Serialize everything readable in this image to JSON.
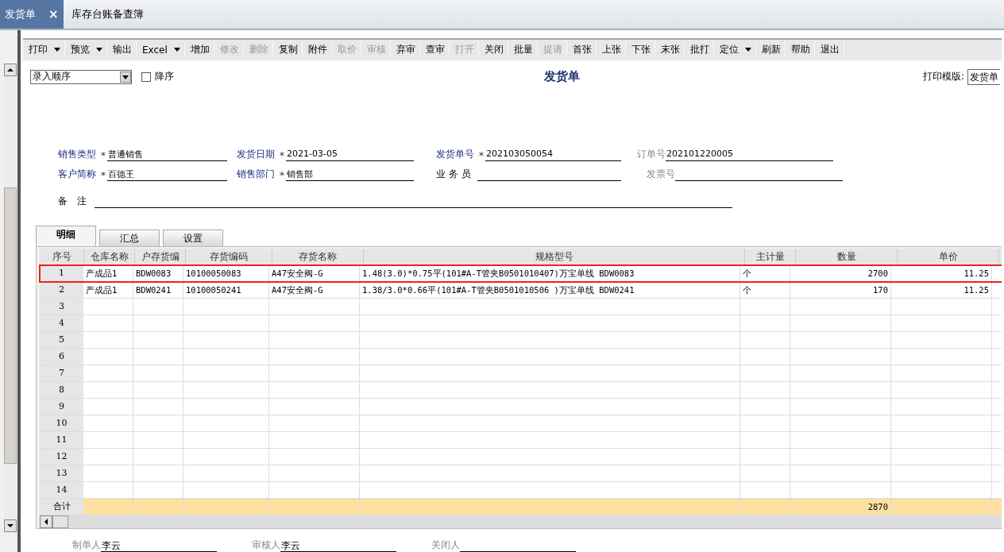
{
  "doc_tabs": [
    {
      "label": "发货单",
      "selected": true,
      "close": "×"
    },
    {
      "label": "库存台账备查簿",
      "selected": false
    }
  ],
  "toolbar": [
    {
      "label": "打印",
      "disabled": false,
      "dropdown": true
    },
    {
      "label": "预览",
      "disabled": false,
      "dropdown": true
    },
    {
      "label": "输出",
      "disabled": false,
      "dropdown": false
    },
    {
      "label": "Excel",
      "disabled": false,
      "dropdown": true
    },
    {
      "label": "增加",
      "disabled": false,
      "dropdown": false
    },
    {
      "label": "修改",
      "disabled": true,
      "dropdown": false
    },
    {
      "label": "删除",
      "disabled": true,
      "dropdown": false
    },
    {
      "label": "复制",
      "disabled": false,
      "dropdown": false
    },
    {
      "label": "附件",
      "disabled": false,
      "dropdown": false
    },
    {
      "label": "取价",
      "disabled": true,
      "dropdown": false
    },
    {
      "label": "审核",
      "disabled": true,
      "dropdown": false
    },
    {
      "label": "弃审",
      "disabled": false,
      "dropdown": false
    },
    {
      "label": "查审",
      "disabled": false,
      "dropdown": false
    },
    {
      "label": "打开",
      "disabled": true,
      "dropdown": false
    },
    {
      "label": "关闭",
      "disabled": false,
      "dropdown": false
    },
    {
      "label": "批量",
      "disabled": false,
      "dropdown": false
    },
    {
      "label": "提请",
      "disabled": true,
      "dropdown": false
    },
    {
      "label": "首张",
      "disabled": false,
      "dropdown": false
    },
    {
      "label": "上张",
      "disabled": false,
      "dropdown": false
    },
    {
      "label": "下张",
      "disabled": false,
      "dropdown": false
    },
    {
      "label": "末张",
      "disabled": false,
      "dropdown": false
    },
    {
      "label": "批打",
      "disabled": false,
      "dropdown": false
    },
    {
      "label": "定位",
      "disabled": false,
      "dropdown": true
    },
    {
      "label": "刷新",
      "disabled": false,
      "dropdown": false
    },
    {
      "label": "帮助",
      "disabled": false,
      "dropdown": false
    },
    {
      "label": "退出",
      "disabled": false,
      "dropdown": false
    }
  ],
  "sort": {
    "value": "录入顺序",
    "descending_label": "降序",
    "descending": false
  },
  "title": "发货单",
  "print_template": {
    "label": "打印模版:",
    "value": "发货单"
  },
  "header_fields": [
    [
      {
        "label": "销售类型",
        "kind": "primary",
        "required_mark": "*",
        "value": "普通销售"
      },
      {
        "label": "发货日期",
        "kind": "primary",
        "required_mark": "*",
        "value": "2021-03-05"
      },
      {
        "label": "发货单号",
        "kind": "primary",
        "required_mark": "*",
        "value": "202103050054"
      },
      {
        "label": "订单号",
        "kind": "muted",
        "value": "202101220005"
      }
    ],
    [
      {
        "label": "客户简称",
        "kind": "primary",
        "required_mark": "*",
        "value": "百德王"
      },
      {
        "label": "销售部门",
        "kind": "primary",
        "required_mark": "*",
        "value": "销售部"
      },
      {
        "label": "业 务 员",
        "kind": "plain"
      },
      {
        "label": "发票号",
        "kind": "muted"
      }
    ]
  ],
  "remark": {
    "label": "备　注"
  },
  "detail_tabs": [
    {
      "label": "明细",
      "selected": true
    },
    {
      "label": "汇总",
      "selected": false
    },
    {
      "label": "设置",
      "selected": false
    }
  ],
  "table": {
    "columns": [
      {
        "label": "序号"
      },
      {
        "label": "仓库名称"
      },
      {
        "label": "户存货编"
      },
      {
        "label": "存货编码"
      },
      {
        "label": "存货名称"
      },
      {
        "label": "规格型号"
      },
      {
        "label": "主计量"
      },
      {
        "label": "数量"
      },
      {
        "label": "单价"
      }
    ],
    "rows": [
      {
        "no": "1",
        "highlighted": true,
        "cells": [
          "产成品1",
          "BDW0083",
          "10100050083",
          "A47安全阀-G",
          "1.48(3.0)*0.75平(101#A-T管夹B0501010407)万宝单线  BDW0083",
          "个",
          "2700",
          "11.25"
        ]
      },
      {
        "no": "2",
        "highlighted": false,
        "cells": [
          "产成品1",
          "BDW0241",
          "10100050241",
          "A47安全阀-G",
          "1.38/3.0*0.66平(101#A-T管夹B0501010506 )万宝单线  BDW0241",
          "个",
          "170",
          "11.25"
        ]
      },
      {
        "no": "3"
      },
      {
        "no": "4"
      },
      {
        "no": "5"
      },
      {
        "no": "6"
      },
      {
        "no": "7"
      },
      {
        "no": "8"
      },
      {
        "no": "9"
      },
      {
        "no": "10"
      },
      {
        "no": "11"
      },
      {
        "no": "12"
      },
      {
        "no": "13"
      },
      {
        "no": "14"
      }
    ],
    "total": {
      "label": "合计",
      "quantity": "2870"
    }
  },
  "footer": [
    {
      "label": "制单人",
      "value": "李云"
    },
    {
      "label": "审核人",
      "value": "李云"
    },
    {
      "label": "关闭人"
    }
  ]
}
